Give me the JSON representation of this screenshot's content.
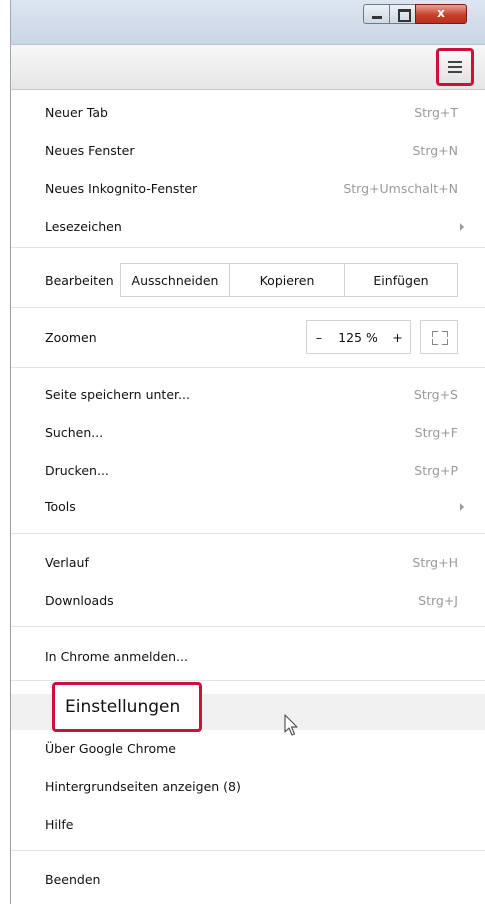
{
  "window": {
    "close_glyph": "x"
  },
  "menu": {
    "new_tab": {
      "label": "Neuer Tab",
      "shortcut": "Strg+T"
    },
    "new_window": {
      "label": "Neues Fenster",
      "shortcut": "Strg+N"
    },
    "incognito": {
      "label": "Neues Inkognito-Fenster",
      "shortcut": "Strg+Umschalt+N"
    },
    "bookmarks": {
      "label": "Lesezeichen"
    },
    "edit": {
      "label": "Bearbeiten",
      "cut": "Ausschneiden",
      "copy": "Kopieren",
      "paste": "Einfügen"
    },
    "zoom": {
      "label": "Zoomen",
      "minus": "–",
      "level": "125 %",
      "plus": "+"
    },
    "save_page": {
      "label": "Seite speichern unter...",
      "shortcut": "Strg+S"
    },
    "find": {
      "label": "Suchen...",
      "shortcut": "Strg+F"
    },
    "print": {
      "label": "Drucken...",
      "shortcut": "Strg+P"
    },
    "tools": {
      "label": "Tools"
    },
    "history": {
      "label": "Verlauf",
      "shortcut": "Strg+H"
    },
    "downloads": {
      "label": "Downloads",
      "shortcut": "Strg+J"
    },
    "sign_in": {
      "label": "In Chrome anmelden..."
    },
    "settings": {
      "label": "Einstellungen"
    },
    "about": {
      "label": "Über Google Chrome"
    },
    "background_pages": {
      "label": "Hintergrundseiten anzeigen (8)"
    },
    "help": {
      "label": "Hilfe"
    },
    "exit": {
      "label": "Beenden"
    }
  },
  "colors": {
    "highlight": "#c8143c",
    "shortcut_text": "#9a9a9a"
  }
}
